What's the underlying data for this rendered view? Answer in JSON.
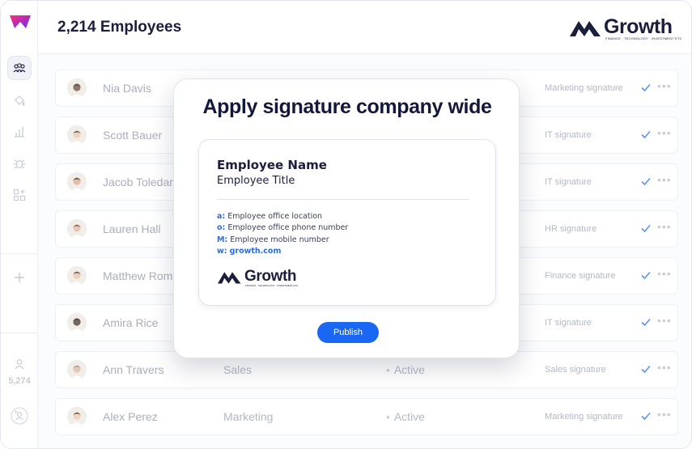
{
  "header": {
    "title": "2,214 Employees",
    "brand_name": "Growth",
    "brand_tagline": "FINANCE · TECHNOLOGY · INVESTMENT ETC"
  },
  "sidebar": {
    "items": [
      {
        "icon": "users-icon",
        "active": true
      },
      {
        "icon": "paint-bucket-icon",
        "active": false
      },
      {
        "icon": "bar-chart-icon",
        "active": false
      },
      {
        "icon": "bug-icon",
        "active": false
      },
      {
        "icon": "apps-add-icon",
        "active": false
      },
      {
        "icon": "plus-icon",
        "active": false
      }
    ],
    "user_count": "5,274"
  },
  "employees": [
    {
      "name": "Nia Davis",
      "department": "",
      "status": "",
      "signature": "Marketing signature"
    },
    {
      "name": "Scott Bauer",
      "department": "",
      "status": "",
      "signature": "IT signature"
    },
    {
      "name": "Jacob Toledano",
      "department": "",
      "status": "",
      "signature": "IT signature"
    },
    {
      "name": "Lauren Hall",
      "department": "",
      "status": "",
      "signature": "HR signature"
    },
    {
      "name": "Matthew Romano",
      "department": "",
      "status": "",
      "signature": "Finance signature"
    },
    {
      "name": "Amira Rice",
      "department": "",
      "status": "",
      "signature": "IT signature"
    },
    {
      "name": "Ann Travers",
      "department": "Sales",
      "status": "Active",
      "signature": "Sales signature"
    },
    {
      "name": "Alex Perez",
      "department": "Marketing",
      "status": "Active",
      "signature": "Marketing signature"
    }
  ],
  "modal": {
    "title": "Apply signature company wide",
    "employee_name": "Employee Name",
    "employee_title": "Employee Title",
    "contacts": [
      {
        "key": "a:",
        "value": "Employee office location"
      },
      {
        "key": "o:",
        "value": "Employee office phone number"
      },
      {
        "key": "M:",
        "value": "Employee mobile number"
      },
      {
        "key": "w:",
        "value": "growth.com"
      }
    ],
    "brand_name": "Growth",
    "brand_tagline": "FINANCE · TECHNOLOGY · INVESTMENT ETC",
    "publish_label": "Publish"
  },
  "colors": {
    "accent": "#1967f2",
    "brand_dark": "#1b1f3b",
    "logo_gradient_start": "#ff2d7a",
    "logo_gradient_end": "#6b2cf5"
  }
}
